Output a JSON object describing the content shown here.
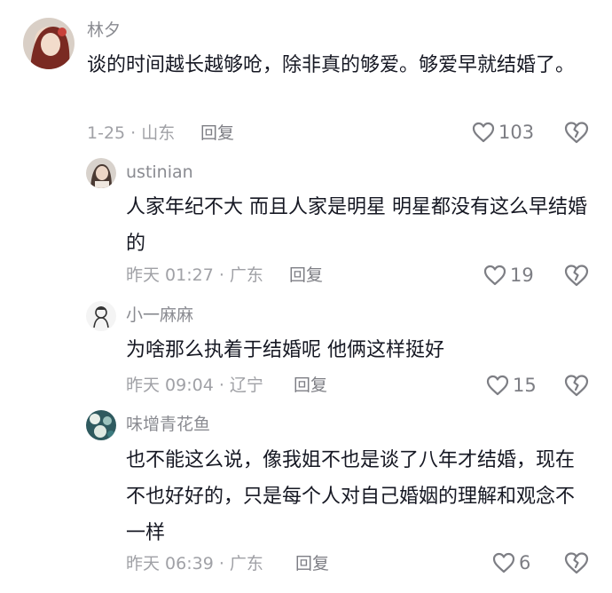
{
  "comments": [
    {
      "user": "林夕",
      "text": "谈的时间越长越够呛，除非真的够爱。够爱早就结婚了。",
      "date_location": "1-25 · 山东",
      "reply_label": "回复",
      "likes": "103",
      "avatar_icon": "avatar-photo-red-hair"
    }
  ],
  "replies": [
    {
      "user": "ustinian",
      "text": "人家年纪不大 而且人家是明星 明星都没有这么早结婚的",
      "date_location": "昨天 01:27 · 广东",
      "reply_label": "回复",
      "likes": "19",
      "avatar_icon": "avatar-photo-girl"
    },
    {
      "user": "小一麻麻",
      "text": "为啥那么执着于结婚呢 他俩这样挺好",
      "date_location": "昨天 09:04 · 辽宁",
      "reply_label": "回复",
      "likes": "15",
      "avatar_icon": "avatar-sketch"
    },
    {
      "user": "味增青花鱼",
      "text": "也不能这么说，像我姐不也是谈了八年才结婚，现在不也好好的，只是每个人对自己婚姻的理解和观念不一样",
      "date_location": "昨天 06:39 · 广东",
      "reply_label": "回复",
      "likes": "6",
      "avatar_icon": "avatar-teal-pattern"
    }
  ],
  "icons": {
    "like": "heart-outline-icon",
    "dislike": "broken-heart-icon"
  },
  "colors": {
    "name": "#8a8b91",
    "text": "#161823",
    "meta": "#a0a1a6"
  }
}
